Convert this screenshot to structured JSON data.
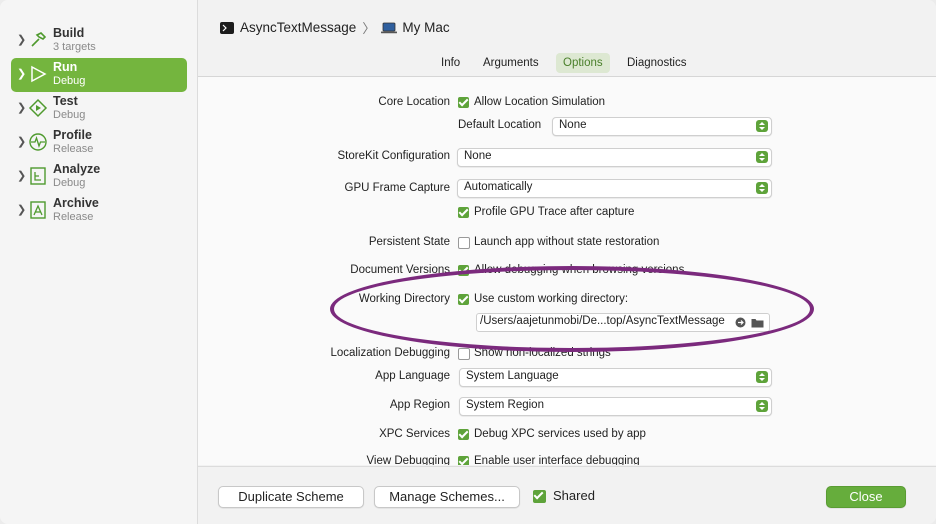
{
  "sidebar": {
    "items": [
      {
        "title": "Build",
        "subtitle": "3 targets",
        "icon": "hammer-icon"
      },
      {
        "title": "Run",
        "subtitle": "Debug",
        "icon": "play-icon"
      },
      {
        "title": "Test",
        "subtitle": "Debug",
        "icon": "test-diamond-icon"
      },
      {
        "title": "Profile",
        "subtitle": "Release",
        "icon": "waveform-icon"
      },
      {
        "title": "Analyze",
        "subtitle": "Debug",
        "icon": "analyze-icon"
      },
      {
        "title": "Archive",
        "subtitle": "Release",
        "icon": "archive-icon"
      }
    ],
    "selected_index": 1
  },
  "header": {
    "scheme": "AsyncTextMessage",
    "destination": "My Mac"
  },
  "tabs": [
    "Info",
    "Arguments",
    "Options",
    "Diagnostics"
  ],
  "active_tab": "Options",
  "options": {
    "core_location_label": "Core Location",
    "allow_location_simulation": "Allow Location Simulation",
    "default_location_label": "Default Location",
    "default_location_value": "None",
    "storekit_label": "StoreKit Configuration",
    "storekit_value": "None",
    "gpu_frame_capture_label": "GPU Frame Capture",
    "gpu_frame_capture_value": "Automatically",
    "profile_gpu_trace": "Profile GPU Trace after capture",
    "persistent_state_label": "Persistent State",
    "persistent_state_text": "Launch app without state restoration",
    "document_versions_label": "Document Versions",
    "document_versions_text": "Allow debugging when browsing versions",
    "working_directory_label": "Working Directory",
    "working_directory_text": "Use custom working directory:",
    "working_directory_path": "/Users/aajetunmobi/De...top/AsyncTextMessage",
    "localization_label": "Localization Debugging",
    "localization_text": "Show non-localized strings",
    "app_language_label": "App Language",
    "app_language_value": "System Language",
    "app_region_label": "App Region",
    "app_region_value": "System Region",
    "xpc_label": "XPC Services",
    "xpc_text": "Debug XPC services used by app",
    "view_debugging_label": "View Debugging",
    "view_debugging_text": "Enable user interface debugging"
  },
  "footer": {
    "duplicate": "Duplicate Scheme",
    "manage": "Manage Schemes...",
    "shared": "Shared",
    "close": "Close"
  },
  "colors": {
    "accent": "#74b53e",
    "annotation": "#7b2a7d"
  }
}
